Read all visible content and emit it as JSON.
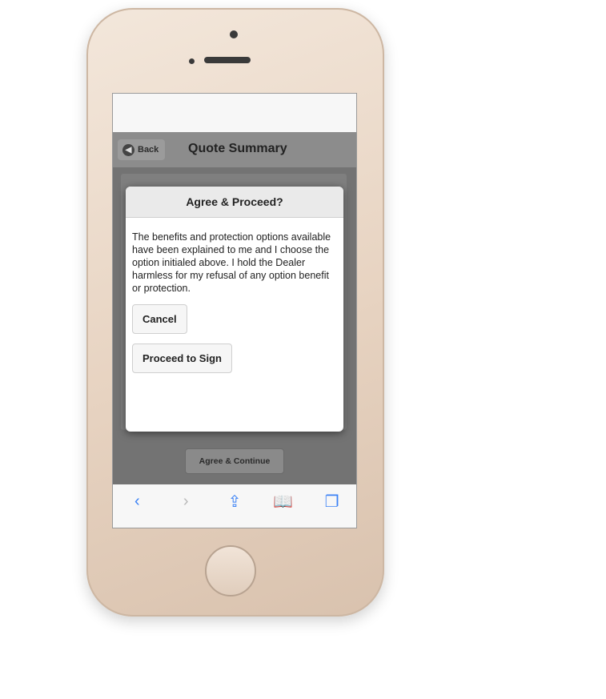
{
  "header": {
    "back_label": "Back",
    "title": "Quote Summary"
  },
  "modal": {
    "title": "Agree & Proceed?",
    "body": "The benefits and protection options available have been explained to me and I choose the option initialed above. I hold the Dealer harmless for my refusal of any option benefit or protection.",
    "cancel_label": "Cancel",
    "proceed_label": "Proceed to Sign"
  },
  "footer": {
    "agree_label": "Agree & Continue"
  },
  "browser_toolbar": {
    "back_icon": "‹",
    "forward_icon": "›",
    "share_icon": "⇪",
    "bookmarks_icon": "📖",
    "tabs_icon": "❐"
  }
}
